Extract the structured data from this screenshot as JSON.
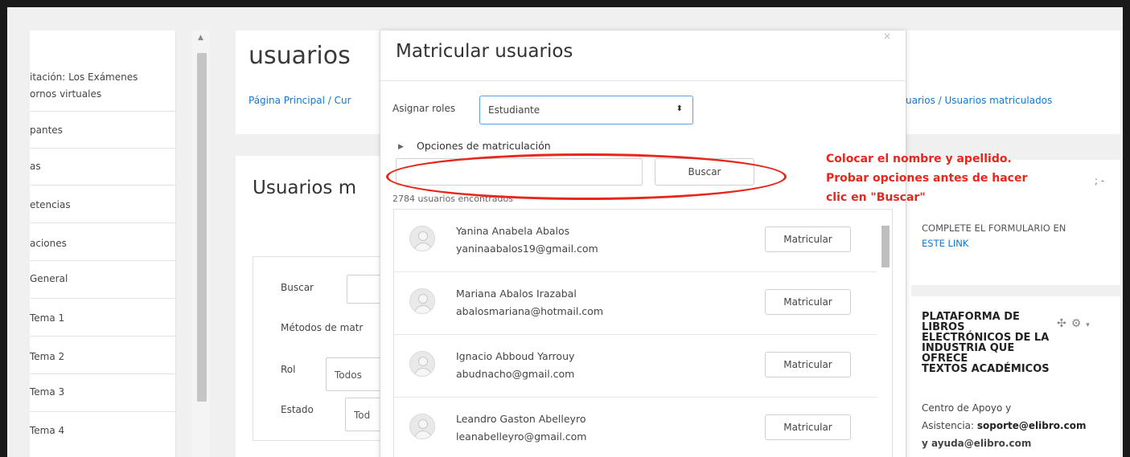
{
  "sidebar": {
    "items": [
      {
        "label": "itación: Los Exámenes"
      },
      {
        "label": "ornos virtuales"
      },
      {
        "label": "pantes"
      },
      {
        "label": "as"
      },
      {
        "label": "etencias"
      },
      {
        "label": "aciones"
      },
      {
        "label": "General"
      },
      {
        "label": "Tema 1"
      },
      {
        "label": "Tema 2"
      },
      {
        "label": "Tema 3"
      },
      {
        "label": "Tema 4"
      }
    ]
  },
  "page": {
    "title": "usuarios",
    "breadcrumb_left": "Página Principal / Cur",
    "breadcrumb_right": "uarios / Usuarios matriculados",
    "section_title": "Usuarios m",
    "filters": {
      "search_label": "Buscar",
      "methods_label": "Métodos de matr",
      "role_label": "Rol",
      "role_value": "Todos",
      "status_label": "Estado",
      "status_value": "Tod"
    }
  },
  "right_column": {
    "gear_icon_partial": "; -",
    "complete_form_text": "COMPLETE EL FORMULARIO EN",
    "complete_form_link": "ESTE LINK",
    "platform_title_lines": [
      "PLATAFORMA DE",
      "LIBROS",
      "ELECTRÓNICOS DE LA",
      "INDUSTRIA QUE OFRECE",
      "TEXTOS ACADÉMICOS"
    ],
    "support_line1": "Centro de Apoyo y",
    "support_line2_prefix": "Asistencia: ",
    "support_email": "soporte@elibro.com",
    "support_line3": "y ayuda@elibro.com"
  },
  "modal": {
    "title": "Matricular usuarios",
    "close_icon": "×",
    "roles_label": "Asignar roles",
    "roles_value": "Estudiante",
    "options_label": "Opciones de matriculación",
    "search_placeholder": "",
    "search_button": "Buscar",
    "found_count": "2784 usuarios encontrados",
    "users": [
      {
        "name": "Yanina Anabela Abalos",
        "email": "yaninaabalos19@gmail.com",
        "action": "Matricular"
      },
      {
        "name": "Mariana Abalos Irazabal",
        "email": "abalosmariana@hotmail.com",
        "action": "Matricular"
      },
      {
        "name": "Ignacio Abboud Yarrouy",
        "email": "abudnacho@gmail.com",
        "action": "Matricular"
      },
      {
        "name": "Leandro Gaston Abelleyro",
        "email": "leanabelleyro@gmail.com",
        "action": "Matricular"
      }
    ]
  },
  "annotation": {
    "lines": [
      "Colocar el nombre y apellido.",
      "Probar opciones antes de hacer",
      "clic en \"Buscar\""
    ],
    "color": "#e8261c"
  },
  "colors": {
    "link": "#1177d1",
    "focus_border": "#5aa0e6"
  }
}
